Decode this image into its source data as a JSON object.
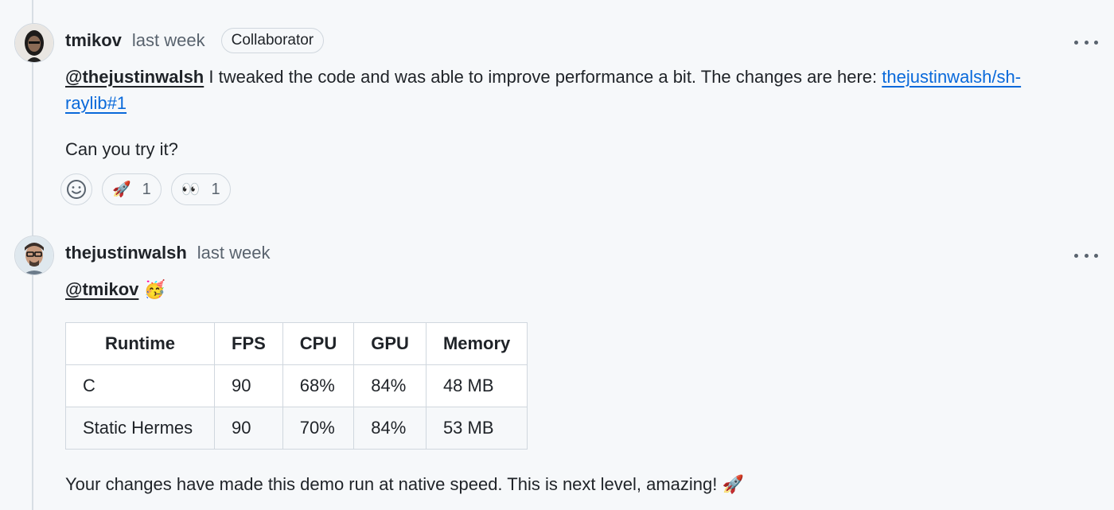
{
  "comments": [
    {
      "author": "tmikov",
      "timestamp": "last week",
      "role_badge": "Collaborator",
      "mention": "@thejustinwalsh",
      "text": " I tweaked the code and was able to improve performance a bit. The changes are here: ",
      "link_text": "thejustinwalsh/sh-raylib#1",
      "paragraph2": "Can you try it?",
      "reactions": [
        {
          "emoji": "🚀",
          "icon": "rocket-icon",
          "count": "1"
        },
        {
          "emoji": "👀",
          "icon": "eyes-icon",
          "count": "1"
        }
      ]
    },
    {
      "author": "thejustinwalsh",
      "timestamp": "last week",
      "mention": "@tmikov",
      "mention_emoji": "🥳",
      "table": {
        "headers": [
          "Runtime",
          "FPS",
          "CPU",
          "GPU",
          "Memory"
        ],
        "rows": [
          [
            "C",
            "90",
            "68%",
            "84%",
            "48 MB"
          ],
          [
            "Static Hermes",
            "90",
            "70%",
            "84%",
            "53 MB"
          ]
        ]
      },
      "closing": "Your changes have made this demo run at native speed. This is next level, amazing!",
      "closing_emoji": "🚀"
    }
  ],
  "colors": {
    "background": "#f6f8fa",
    "link": "#0969da",
    "muted": "#59636e",
    "border": "#d0d7de"
  }
}
